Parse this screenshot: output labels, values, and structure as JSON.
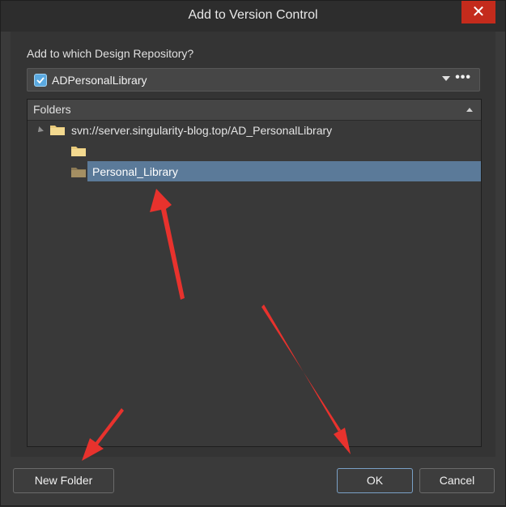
{
  "dialog": {
    "title": "Add to Version Control",
    "close_glyph": "✕"
  },
  "repository": {
    "label": "Add to which Design Repository?",
    "selected": "ADPersonalLibrary",
    "more_glyph": "•••",
    "icon": "repository-icon"
  },
  "tree": {
    "header": "Folders",
    "root": {
      "label": "svn://server.singularity-blog.top/AD_PersonalLibrary",
      "icon": "folder-icon"
    },
    "children": [
      {
        "label": "",
        "icon": "folder-icon"
      },
      {
        "label": "Personal_Library",
        "icon": "folder-icon",
        "selected": true
      }
    ]
  },
  "buttons": {
    "new_folder": "New Folder",
    "ok": "OK",
    "cancel": "Cancel"
  },
  "colors": {
    "selection": "#5b7a99",
    "annotation_arrow": "#e8322d",
    "close_button": "#c42b1c"
  }
}
